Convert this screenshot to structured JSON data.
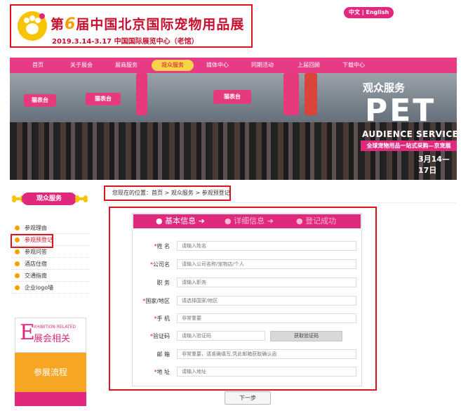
{
  "header": {
    "title_prefix": "第",
    "title_num": "6",
    "title_rest": "届中国北京国际宠物用品展",
    "subtitle": "2019.3.14-3.17   中国国际展览中心（老馆）",
    "lang": "中文 | English"
  },
  "nav": {
    "items": [
      {
        "label": "首页"
      },
      {
        "label": "关于展会"
      },
      {
        "label": "展商服务"
      },
      {
        "label": "观众服务"
      },
      {
        "label": "媒体中心"
      },
      {
        "label": "同期活动"
      },
      {
        "label": "上届回顾"
      },
      {
        "label": "下载中心"
      }
    ],
    "active_index": 3
  },
  "banner": {
    "caption": "观众服务",
    "pet": "PET",
    "aud": "AUDIENCE SERVICE",
    "strip": "全球宠物用品一站式采购—京宠展",
    "date": "3月14—17日",
    "booths": [
      "猫表台",
      "猫表台",
      "猫表台"
    ]
  },
  "sidebar": {
    "title": "观众服务",
    "items": [
      {
        "label": "参观理由"
      },
      {
        "label": "参观预登记"
      },
      {
        "label": "参观问答"
      },
      {
        "label": "酒店住宿"
      },
      {
        "label": "交通指南"
      },
      {
        "label": "企业logo墙"
      }
    ],
    "active_index": 1,
    "exhibition": {
      "letter": "E",
      "en": "XHIBITION RELATED",
      "zh": "展会相关"
    },
    "flow": "参展流程"
  },
  "breadcrumb": "您现在的位置：首页 > 观众服务 > 参观预登记",
  "form": {
    "steps": [
      "● 基本信息 ➔",
      "● 详细信息 ➔",
      "● 登记成功"
    ],
    "fields": [
      {
        "label": "姓 名",
        "required": "*",
        "placeholder": "请输入姓名"
      },
      {
        "label": "公司名",
        "required": "*",
        "placeholder": "请输入公司名称/宠物店/个人"
      },
      {
        "label": "职 务",
        "required": "",
        "placeholder": "请输入职务"
      },
      {
        "label": "国家/地区",
        "required": "*",
        "placeholder": "请选择国家/地区"
      },
      {
        "label": "手 机",
        "required": "*",
        "placeholder": "非常重要"
      },
      {
        "label": "验证码",
        "required": "*",
        "placeholder": "请输入验证码"
      },
      {
        "label": "邮 箱",
        "required": "",
        "placeholder": "非常重要，请准确填写,凭此邮箱获取确认函"
      },
      {
        "label": "地 址",
        "required": "*",
        "placeholder": "请输入地址"
      }
    ],
    "code_button": "获取验证码",
    "next_button": "下一步"
  },
  "colors": {
    "accent": "#e0287c",
    "highlight_border": "#e0141f",
    "orange": "#f6a623"
  }
}
